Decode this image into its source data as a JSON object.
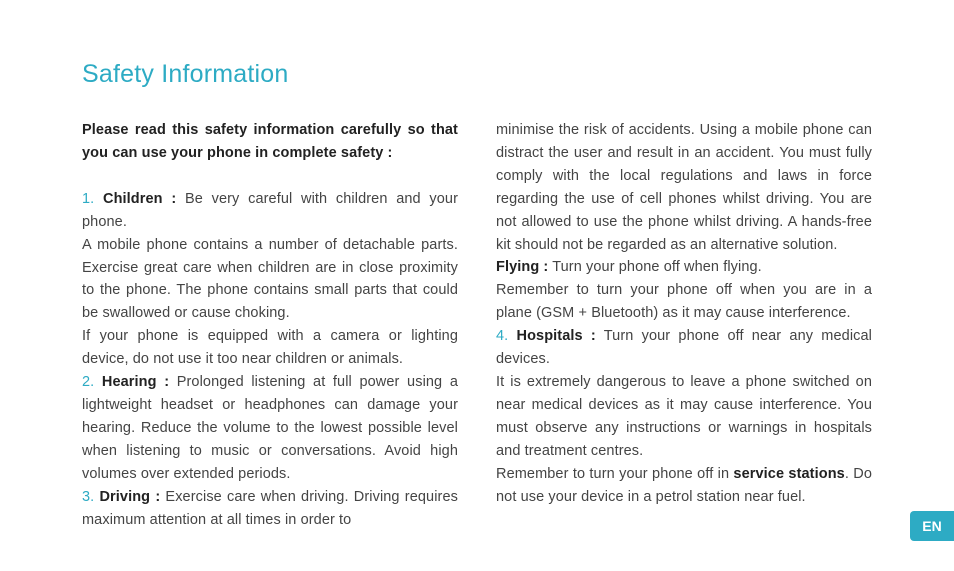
{
  "colors": {
    "accent": "#2dabc4"
  },
  "title": "Safety Information",
  "intro": "Please read this safety information carefully so that you can use your phone in complete safety :",
  "items": {
    "n1": "1.",
    "children_label": "Children :",
    "children_1": " Be very careful with children and your phone.",
    "children_2": "A mobile phone contains a number of detachable parts. Exercise great care when children are in close proximity to the phone. The phone contains small parts that could be swallowed or cause choking.",
    "children_3": "If your phone is equipped with a camera or lighting device, do not use it too near children or animals.",
    "n2": "2.",
    "hearing_label": "Hearing :",
    "hearing_1": " Prolonged listening at full power using a lightweight headset or headphones can damage your hearing. Reduce the volume to the lowest possible level when listening to music or conversations. Avoid high volumes over extended periods.",
    "n3": "3.",
    "driving_label": "Driving :",
    "driving_1": " Exercise care when driving. Driving re­quires maximum attention at all times in order to ",
    "driving_2": "minimise the risk of accidents. Using a mobile phone can distract the user and result in an accident. You must fully comply with the local regulations and laws in force regarding the use of cell phones whilst driving. You are not allowed to use the phone whilst driving. A hands-free kit should not be regarded as an alter­native solution.",
    "flying_label": "Flying :",
    "flying_1": " Turn your phone off when flying.",
    "flying_2": "Remember to turn your phone off when you are in a plane (GSM + Bluetooth) as it may cause interference.",
    "n4": "4.",
    "hospitals_label": "Hospitals :",
    "hospitals_1": " Turn your phone off near any medical devices.",
    "hospitals_2": "It is extremely dangerous to leave a phone switched on near medical devices as it may cause interference. You must observe any instructions or warnings in hospi­tals and treatment centres.",
    "service_pre": "Remember to turn your phone off in ",
    "service_label": "service stations",
    "service_post": ". Do not use your device in a petrol station near fuel."
  },
  "lang": "EN"
}
